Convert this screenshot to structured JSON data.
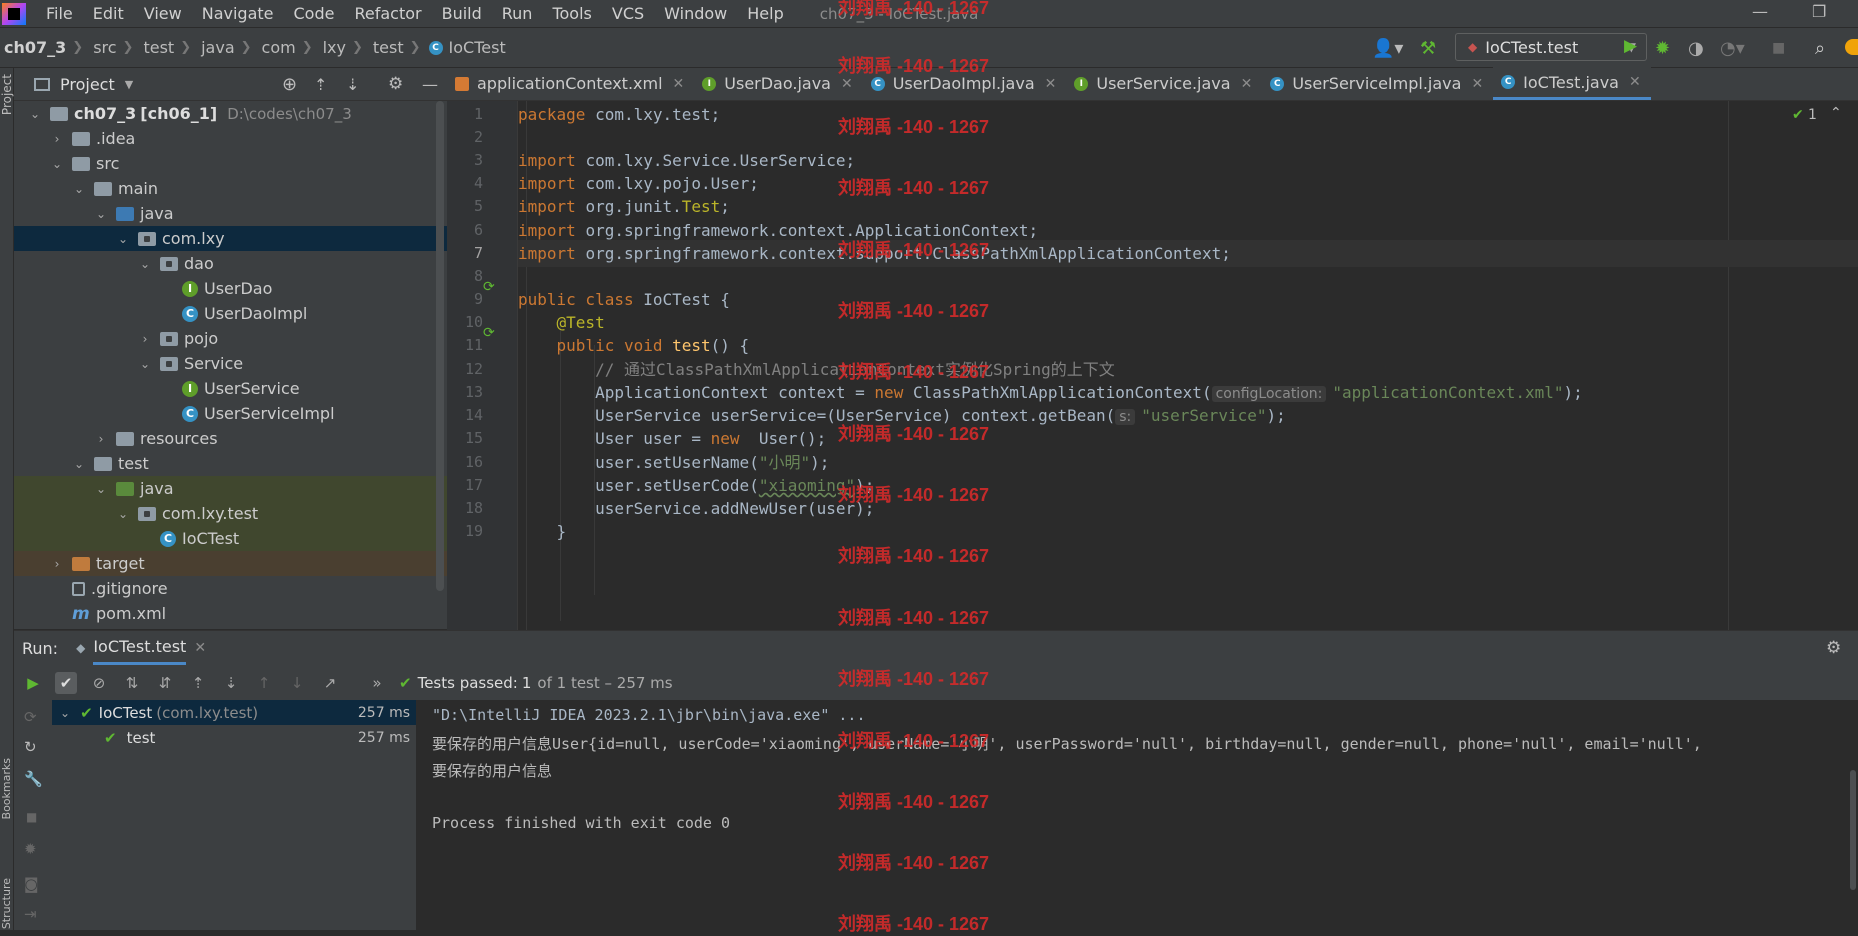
{
  "menubar": {
    "items": [
      "File",
      "Edit",
      "View",
      "Navigate",
      "Code",
      "Refactor",
      "Build",
      "Run",
      "Tools",
      "VCS",
      "Window",
      "Help"
    ],
    "window_title": "ch07_3 - IoCTest.java"
  },
  "breadcrumb": {
    "project": "ch07_3",
    "parts": [
      "src",
      "test",
      "java",
      "com",
      "lxy",
      "test"
    ],
    "file": "IoCTest"
  },
  "toolbar": {
    "run_config": "IoCTest.test"
  },
  "project_panel": {
    "title": "Project",
    "root_label": "ch07_3 [ch06_1]",
    "root_path": "D:\\codes\\ch07_3",
    "tree": [
      {
        "label": "ch07_3 [ch06_1]",
        "depth": 0,
        "icon": "folder-gray",
        "chev": "v"
      },
      {
        "label": ".idea",
        "depth": 1,
        "icon": "folder-gray",
        "chev": ">"
      },
      {
        "label": "src",
        "depth": 1,
        "icon": "folder-gray",
        "chev": "v"
      },
      {
        "label": "main",
        "depth": 2,
        "icon": "folder-gray",
        "chev": "v"
      },
      {
        "label": "java",
        "depth": 3,
        "icon": "folder-blue",
        "chev": "v"
      },
      {
        "label": "com.lxy",
        "depth": 4,
        "icon": "package",
        "chev": "v"
      },
      {
        "label": "dao",
        "depth": 5,
        "icon": "package",
        "chev": "v"
      },
      {
        "label": "UserDao",
        "depth": 6,
        "icon": "interface",
        "chev": ""
      },
      {
        "label": "UserDaoImpl",
        "depth": 6,
        "icon": "class",
        "chev": ""
      },
      {
        "label": "pojo",
        "depth": 5,
        "icon": "package",
        "chev": ">"
      },
      {
        "label": "Service",
        "depth": 5,
        "icon": "package",
        "chev": "v"
      },
      {
        "label": "UserService",
        "depth": 6,
        "icon": "interface",
        "chev": ""
      },
      {
        "label": "UserServiceImpl",
        "depth": 6,
        "icon": "class",
        "chev": ""
      },
      {
        "label": "resources",
        "depth": 3,
        "icon": "folder-gray",
        "chev": ">"
      },
      {
        "label": "test",
        "depth": 2,
        "icon": "folder-gray",
        "chev": "v"
      },
      {
        "label": "java",
        "depth": 3,
        "icon": "folder-green",
        "chev": "v"
      },
      {
        "label": "com.lxy.test",
        "depth": 4,
        "icon": "package",
        "chev": "v"
      },
      {
        "label": "IoCTest",
        "depth": 5,
        "icon": "class",
        "chev": ""
      },
      {
        "label": "target",
        "depth": 1,
        "icon": "folder-orange",
        "chev": ">"
      },
      {
        "label": ".gitignore",
        "depth": 1,
        "icon": "file",
        "chev": ""
      },
      {
        "label": "pom.xml",
        "depth": 1,
        "icon": "maven",
        "chev": ""
      }
    ]
  },
  "editor_tabs": [
    {
      "label": "applicationContext.xml",
      "icon": "xml"
    },
    {
      "label": "UserDao.java",
      "icon": "interface"
    },
    {
      "label": "UserDaoImpl.java",
      "icon": "class"
    },
    {
      "label": "UserService.java",
      "icon": "interface"
    },
    {
      "label": "UserServiceImpl.java",
      "icon": "class"
    },
    {
      "label": "IoCTest.java",
      "icon": "class"
    }
  ],
  "editor": {
    "inspection_count": "1",
    "lines": [
      "package com.lxy.test;",
      "",
      "import com.lxy.Service.UserService;",
      "import com.lxy.pojo.User;",
      "import org.junit.Test;",
      "import org.springframework.context.ApplicationContext;",
      "import org.springframework.context.support.ClassPathXmlApplicationContext;",
      "",
      "public class IoCTest {",
      "    @Test",
      "    public void test() {",
      "        // 通过ClassPathXmlApplicationContext实例化Spring的上下文",
      "        ApplicationContext context = new ClassPathXmlApplicationContext(configLocation: \"applicationContext.xml\");",
      "        UserService userService=(UserService) context.getBean(s: \"userService\");",
      "        User user = new  User();",
      "        user.setUserName(\"小明\");",
      "        user.setUserCode(\"xiaoming\");",
      "        userService.addNewUser(user);",
      "    }"
    ]
  },
  "run_panel": {
    "label": "Run:",
    "tab": "IoCTest.test",
    "status": "Tests passed:",
    "status_count": "1",
    "status_detail": "of 1 test – 257 ms",
    "tests": [
      {
        "name": "IoCTest",
        "pkg": "(com.lxy.test)",
        "time": "257 ms"
      },
      {
        "name": "test",
        "pkg": "",
        "time": "257 ms"
      }
    ],
    "console": [
      "\"D:\\IntelliJ IDEA 2023.2.1\\jbr\\bin\\java.exe\" ...",
      "要保存的用户信息User{id=null, userCode='xiaoming', userName='小明', userPassword='null', birthday=null, gender=null, phone='null', email='null',",
      "要保存的用户信息",
      "",
      "Process finished with exit code 0"
    ]
  },
  "watermark": "刘翔禹 -140 - 1267",
  "side_labels": {
    "project": "Project",
    "bookmarks": "Bookmarks",
    "structure": "Structure"
  }
}
